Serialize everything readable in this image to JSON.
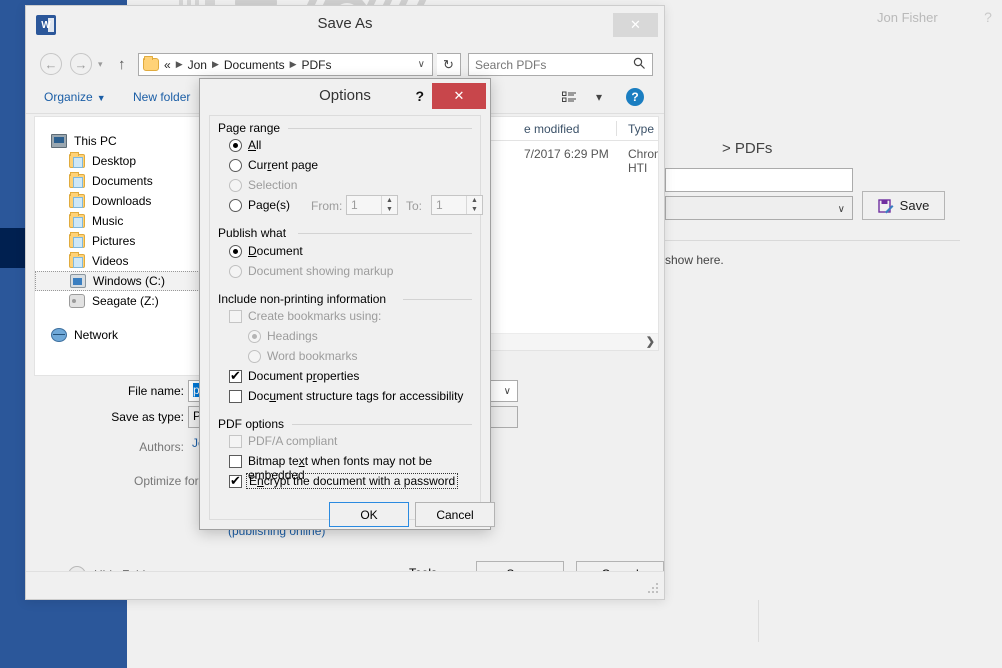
{
  "backstage": {
    "account_name": "Jon Fisher",
    "window_controls": [
      "?",
      "—",
      "❐",
      "✕"
    ],
    "breadcrumb": "> PDFs",
    "filename_value": "",
    "filetype_value": "",
    "save_label": "Save",
    "hint_text": "show here.",
    "save_icon": "save-as-icon"
  },
  "saveas": {
    "title": "Save As",
    "app_icon": "word-icon",
    "close_label": "✕",
    "nav": {
      "back_icon": "←",
      "forward_icon": "→",
      "recent_icon": "▾",
      "up_icon": "↑",
      "address_prefix": "«",
      "address_parts": [
        "Jon",
        "Documents",
        "PDFs"
      ],
      "address_dropdown_icon": "∨",
      "refresh_icon": "↻",
      "search_placeholder": "Search PDFs",
      "search_icon": "⚲"
    },
    "toolbar": {
      "organize": "Organize",
      "new_folder": "New folder",
      "view_caret": "▾",
      "help": "?"
    },
    "tree": [
      {
        "label": "This PC",
        "icon": "pc-icon",
        "level": 0,
        "selected": false
      },
      {
        "label": "Desktop",
        "icon": "folder-icon",
        "level": 1,
        "selected": false
      },
      {
        "label": "Documents",
        "icon": "folder-icon",
        "level": 1,
        "selected": false
      },
      {
        "label": "Downloads",
        "icon": "folder-icon",
        "level": 1,
        "selected": false
      },
      {
        "label": "Music",
        "icon": "folder-icon",
        "level": 1,
        "selected": false
      },
      {
        "label": "Pictures",
        "icon": "folder-icon",
        "level": 1,
        "selected": false
      },
      {
        "label": "Videos",
        "icon": "folder-icon",
        "level": 1,
        "selected": false
      },
      {
        "label": "Windows (C:)",
        "icon": "drive-icon",
        "level": 1,
        "selected": true
      },
      {
        "label": "Seagate (Z:)",
        "icon": "external-drive-icon",
        "level": 1,
        "selected": false
      },
      {
        "label": "Network",
        "icon": "network-icon",
        "level": 0,
        "selected": false
      }
    ],
    "files": {
      "columns": [
        "e modified",
        "Type"
      ],
      "rows": [
        {
          "modified": "7/2017 6:29 PM",
          "type": "Chrome HTI"
        }
      ]
    },
    "form": {
      "filename_label": "File name:",
      "filename_value": "passw",
      "filetype_label": "Save as type:",
      "filetype_value": "PDF (*.",
      "authors_label": "Authors:",
      "authors_value": "Jon Fis",
      "optimize_label": "Optimize for:",
      "optimize_option_1": "",
      "optimize_option_2": "",
      "optimize_sub": "(publishing online)"
    },
    "buttons": {
      "tools": "Tools",
      "tools_caret": "▾",
      "save": "Save",
      "cancel": "Cancel",
      "hide_folders": "Hide Folders",
      "hide_folders_icon": "▲"
    }
  },
  "options_dialog": {
    "title": "Options",
    "help_label": "?",
    "close_label": "✕",
    "groups": [
      {
        "label": "Page range"
      },
      {
        "label": "Publish what"
      },
      {
        "label": "Include non-printing information"
      },
      {
        "label": "PDF options"
      }
    ],
    "page_range": {
      "all": {
        "label": "All",
        "mnemonic": "A",
        "checked": true,
        "enabled": true
      },
      "current_page": {
        "label": "Current page",
        "mnemonic": "r",
        "checked": false,
        "enabled": true
      },
      "selection": {
        "label": "Selection",
        "checked": false,
        "enabled": false
      },
      "pages": {
        "label": "Page(s)",
        "mnemonic": "g",
        "checked": false,
        "enabled": true
      },
      "from_label": "From:",
      "from_value": "1",
      "to_label": "To:",
      "to_value": "1"
    },
    "publish_what": {
      "document": {
        "label": "Document",
        "mnemonic": "D",
        "checked": true,
        "enabled": true
      },
      "document_markup": {
        "label": "Document showing markup",
        "checked": false,
        "enabled": false
      }
    },
    "non_printing": {
      "create_bookmarks": {
        "label": "Create bookmarks using:",
        "checked": false,
        "enabled": false
      },
      "headings": {
        "label": "Headings",
        "checked": true,
        "enabled": false
      },
      "word_bookmarks": {
        "label": "Word bookmarks",
        "checked": false,
        "enabled": false
      },
      "document_properties": {
        "label": "Document properties",
        "mnemonic": "r",
        "checked": true,
        "enabled": true
      },
      "structure_tags": {
        "label": "Document structure tags for accessibility",
        "mnemonic": "u",
        "checked": false,
        "enabled": true
      }
    },
    "pdf_options": {
      "pdfa": {
        "label": "PDF/A compliant",
        "checked": false,
        "enabled": false
      },
      "bitmap_text": {
        "label": "Bitmap text when fonts may not be embedded",
        "mnemonic": "x",
        "checked": false,
        "enabled": true
      },
      "encrypt": {
        "label": "Encrypt the document with a password",
        "mnemonic": "n",
        "checked": true,
        "enabled": true,
        "focused": true
      }
    },
    "ok_label": "OK",
    "cancel_label": "Cancel"
  },
  "colors": {
    "word_blue": "#2b579a",
    "word_blue_dark": "#002050",
    "close_red": "#c8464b",
    "link_blue": "#1b5ea6",
    "selection_blue": "#0078d7",
    "focus_blue": "#2a8ae0"
  }
}
